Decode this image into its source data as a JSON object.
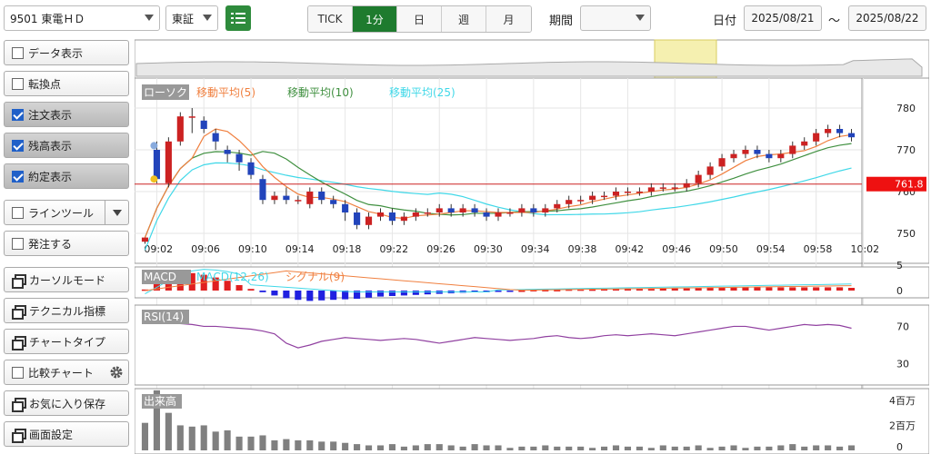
{
  "toolbar": {
    "symbol": "9501 東電ＨＤ",
    "market": "東証",
    "tabs": [
      "TICK",
      "1分",
      "日",
      "週",
      "月"
    ],
    "active_tab": "1分",
    "period_label": "期間",
    "period_value": "",
    "date_label": "日付",
    "date_from": "2025/08/21",
    "date_sep": "～",
    "date_to": "2025/08/22"
  },
  "sidebar": {
    "items": [
      {
        "label": "データ表示",
        "type": "check",
        "checked": false
      },
      {
        "label": "転換点",
        "type": "check",
        "checked": false
      },
      {
        "label": "注文表示",
        "type": "check",
        "checked": true
      },
      {
        "label": "残高表示",
        "type": "check",
        "checked": true
      },
      {
        "label": "約定表示",
        "type": "check",
        "checked": true
      },
      {
        "label": "ラインツール",
        "type": "check",
        "checked": false
      },
      {
        "label": "発注する",
        "type": "check",
        "checked": false
      },
      {
        "label": "カーソルモード",
        "type": "win"
      },
      {
        "label": "テクニカル指標",
        "type": "win"
      },
      {
        "label": "チャートタイプ",
        "type": "win"
      },
      {
        "label": "比較チャート",
        "type": "check",
        "checked": false
      },
      {
        "label": "お気に入り保存",
        "type": "win"
      },
      {
        "label": "画面設定",
        "type": "win"
      }
    ]
  },
  "chart": {
    "legend": [
      "ローソク",
      "移動平均(5)",
      "移動平均(10)",
      "移動平均(25)"
    ],
    "price_ticks": [
      "780",
      "770",
      "760",
      "750"
    ],
    "current_price": "761.8",
    "time_ticks": [
      "09:02",
      "09:06",
      "09:10",
      "09:14",
      "09:18",
      "09:22",
      "09:26",
      "09:30",
      "09:34",
      "09:38",
      "09:42",
      "09:46",
      "09:50",
      "09:54",
      "09:58",
      "10:02"
    ],
    "macd_legend": [
      "MACD",
      "MACD(12,26)",
      "シグナル(9)"
    ],
    "macd_ticks": [
      "5",
      "0"
    ],
    "rsi_legend": "RSI(14)",
    "rsi_ticks": [
      "70",
      "30"
    ],
    "vol_legend": "出来高",
    "vol_ticks": [
      "4百万",
      "2百万",
      "0"
    ]
  },
  "chart_data": {
    "type": "candlestick",
    "ylim": [
      745,
      785
    ],
    "candles": [
      [
        748,
        749,
        747.5,
        749
      ],
      [
        770,
        763,
        762,
        772
      ],
      [
        762,
        772,
        761,
        773
      ],
      [
        772,
        778,
        771,
        779
      ],
      [
        778,
        778,
        774,
        780
      ],
      [
        777,
        775,
        774,
        778
      ],
      [
        774,
        772,
        770,
        775
      ],
      [
        770,
        769,
        767,
        771
      ],
      [
        769,
        767,
        765,
        770
      ],
      [
        767,
        764,
        763,
        768
      ],
      [
        763,
        758,
        757,
        764
      ],
      [
        758,
        759,
        757,
        760
      ],
      [
        759,
        758,
        757,
        761
      ],
      [
        758,
        758,
        757,
        759
      ],
      [
        757,
        760,
        756,
        761
      ],
      [
        760,
        758,
        757,
        761
      ],
      [
        758,
        757,
        756,
        759
      ],
      [
        757,
        755,
        753,
        758
      ],
      [
        755,
        752,
        751,
        756
      ],
      [
        752,
        754,
        751,
        755
      ],
      [
        754,
        755,
        753,
        756
      ],
      [
        755,
        753,
        752,
        756
      ],
      [
        753,
        754,
        752,
        755
      ],
      [
        754,
        755,
        753,
        756
      ],
      [
        755,
        755,
        754,
        756
      ],
      [
        755,
        756,
        754,
        757
      ],
      [
        756,
        755,
        754,
        757
      ],
      [
        755,
        756,
        754,
        757
      ],
      [
        756,
        755,
        754,
        757
      ],
      [
        755,
        754,
        753,
        756
      ],
      [
        754,
        755,
        753,
        756
      ],
      [
        755,
        755,
        754,
        756
      ],
      [
        755,
        756,
        754,
        757
      ],
      [
        756,
        755,
        754,
        757
      ],
      [
        755,
        756,
        754,
        757
      ],
      [
        756,
        757,
        755,
        758
      ],
      [
        757,
        758,
        756,
        759
      ],
      [
        758,
        758,
        757,
        759
      ],
      [
        758,
        759,
        757,
        760
      ],
      [
        759,
        759,
        758,
        760
      ],
      [
        759,
        760,
        758,
        761
      ],
      [
        760,
        760,
        759,
        761
      ],
      [
        760,
        760,
        759,
        761
      ],
      [
        760,
        761,
        759,
        762
      ],
      [
        761,
        761,
        760,
        762
      ],
      [
        761,
        761,
        760,
        762
      ],
      [
        761,
        762,
        760,
        763
      ],
      [
        762,
        764,
        761,
        765
      ],
      [
        764,
        766,
        763,
        767
      ],
      [
        766,
        768,
        765,
        769
      ],
      [
        768,
        769,
        767,
        770
      ],
      [
        769,
        770,
        768,
        771
      ],
      [
        770,
        769,
        768,
        771
      ],
      [
        769,
        768,
        767,
        770
      ],
      [
        768,
        769,
        767,
        770
      ],
      [
        769,
        771,
        768,
        772
      ],
      [
        771,
        772,
        770,
        773
      ],
      [
        772,
        774,
        771,
        775
      ],
      [
        774,
        775,
        773,
        776
      ],
      [
        775,
        774,
        773,
        776
      ],
      [
        774,
        773,
        772,
        775
      ]
    ],
    "volume_millions": [
      2.2,
      4.8,
      3.0,
      2.0,
      1.9,
      2.0,
      1.5,
      1.6,
      1.1,
      1.1,
      1.2,
      0.8,
      0.9,
      0.8,
      0.8,
      0.7,
      0.7,
      0.6,
      0.5,
      0.4,
      0.4,
      0.5,
      0.3,
      0.4,
      0.5,
      0.5,
      0.4,
      0.3,
      0.5,
      0.4,
      0.4,
      0.2,
      0.3,
      0.3,
      0.4,
      0.3,
      0.3,
      0.3,
      0.2,
      0.3,
      0.4,
      0.3,
      0.3,
      0.2,
      0.4,
      0.3,
      0.3,
      0.4,
      0.2,
      0.3,
      0.4,
      0.2,
      0.3,
      0.3,
      0.4,
      0.5,
      0.3,
      0.4,
      0.4,
      0.3,
      0.4
    ],
    "rsi": [
      78,
      77,
      75,
      73,
      72,
      70,
      70,
      69,
      68,
      67,
      65,
      62,
      52,
      47,
      50,
      54,
      56,
      58,
      57,
      56,
      55,
      56,
      57,
      56,
      54,
      52,
      54,
      56,
      58,
      57,
      56,
      55,
      56,
      57,
      59,
      60,
      58,
      57,
      58,
      60,
      61,
      60,
      61,
      62,
      61,
      60,
      62,
      64,
      66,
      68,
      70,
      70,
      68,
      66,
      68,
      70,
      72,
      71,
      72,
      71,
      68
    ],
    "macd_hist": [
      0.2,
      1.8,
      2.6,
      3.0,
      3.2,
      2.9,
      2.4,
      1.8,
      1.0,
      0.3,
      -0.3,
      -0.9,
      -1.4,
      -1.7,
      -1.9,
      -1.8,
      -1.7,
      -1.6,
      -1.5,
      -1.3,
      -1.1,
      -1.0,
      -0.9,
      -0.8,
      -0.7,
      -0.6,
      -0.5,
      -0.4,
      -0.3,
      -0.3,
      -0.2,
      -0.1,
      0.0,
      0.1,
      0.1,
      0.1,
      0.2,
      0.2,
      0.2,
      0.3,
      0.3,
      0.3,
      0.3,
      0.3,
      0.4,
      0.4,
      0.4,
      0.5,
      0.6,
      0.6,
      0.6,
      0.6,
      0.6,
      0.6,
      0.6,
      0.6,
      0.6,
      0.6,
      0.6,
      0.6,
      0.5
    ],
    "colors": {
      "up": "#cc2222",
      "down": "#2244bb",
      "ma5": "#f08040",
      "ma10": "#409040",
      "ma25": "#40d8e8",
      "price_line": "#cc2222",
      "macd_pos": "#e02020",
      "macd_neg": "#2020e0",
      "rsi": "#9040a0",
      "volume": "#808080"
    }
  }
}
